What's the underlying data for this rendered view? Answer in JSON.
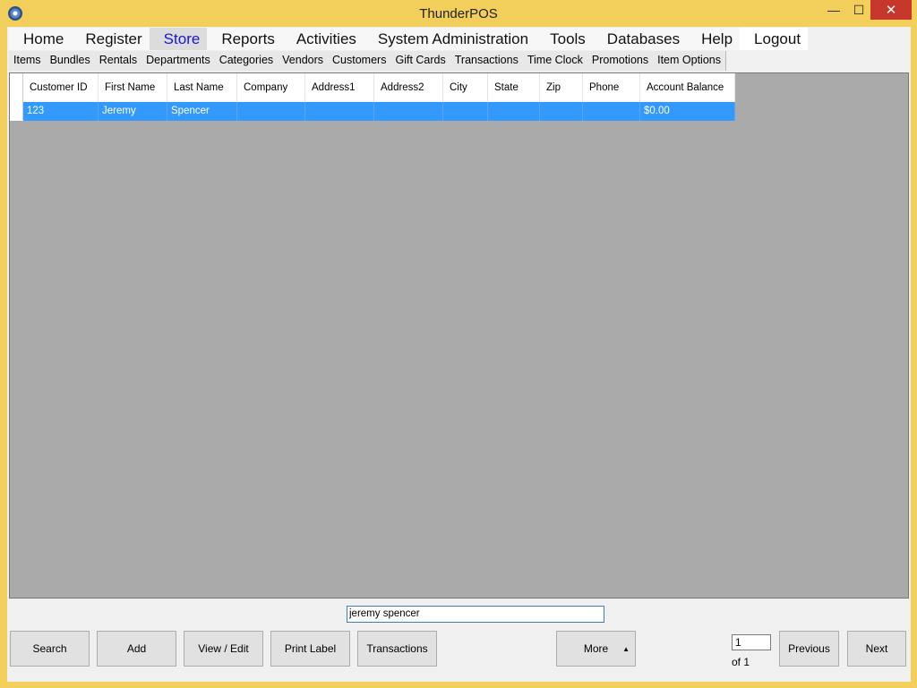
{
  "window": {
    "title": "ThunderPOS",
    "minimize": "—",
    "maximize": "☐",
    "close": "✕"
  },
  "menu": [
    "Home",
    "Register",
    "Store",
    "Reports",
    "Activities",
    "System Administration",
    "Tools",
    "Databases",
    "Help",
    "Logout"
  ],
  "active_menu": "Store",
  "submenu": [
    "Items",
    "Bundles",
    "Rentals",
    "Departments",
    "Categories",
    "Vendors",
    "Customers",
    "Gift Cards",
    "Transactions",
    "Time Clock",
    "Promotions",
    "Item Options"
  ],
  "grid": {
    "columns": [
      "Customer ID",
      "First Name",
      "Last Name",
      "Company",
      "Address1",
      "Address2",
      "City",
      "State",
      "Zip",
      "Phone",
      "Account Balance"
    ],
    "rows": [
      [
        "123",
        "Jeremy",
        "Spencer",
        "",
        "",
        "",
        "",
        "",
        "",
        "",
        "$0.00"
      ]
    ]
  },
  "search": {
    "value": "jeremy spencer"
  },
  "buttons": {
    "search": "Search",
    "add": "Add",
    "view_edit": "View / Edit",
    "print_label": "Print Label",
    "transactions": "Transactions",
    "more": "More",
    "previous": "Previous",
    "next": "Next"
  },
  "pagination": {
    "current": "1",
    "of_label": "of 1"
  }
}
